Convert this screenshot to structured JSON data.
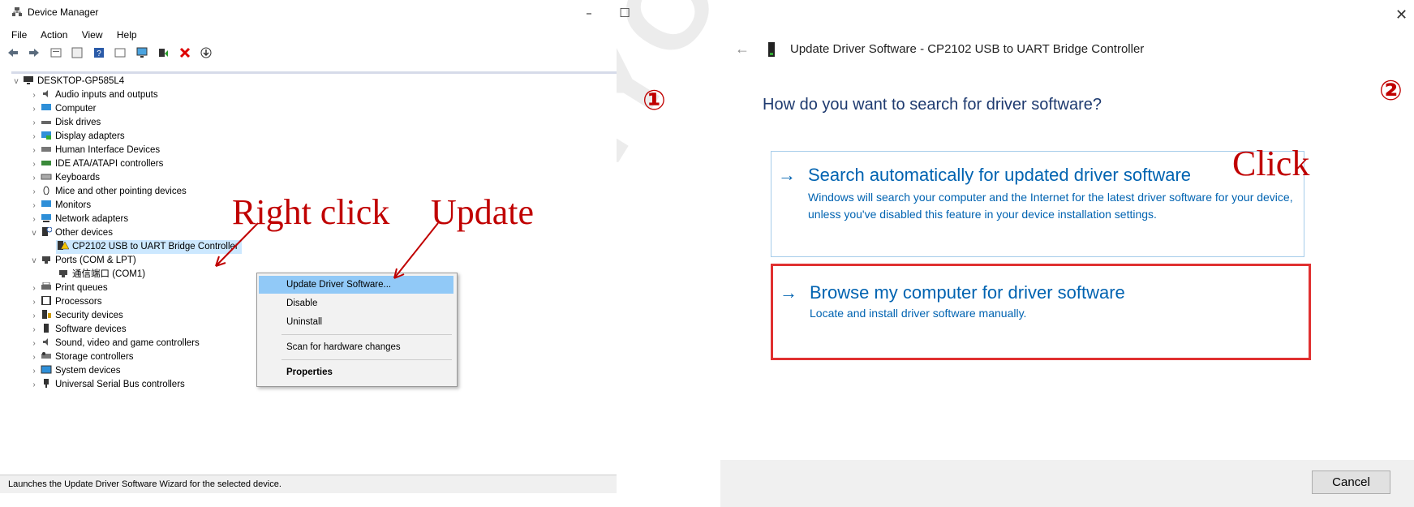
{
  "device_manager": {
    "title": "Device Manager",
    "menu": [
      "File",
      "Action",
      "View",
      "Help"
    ],
    "root": "DESKTOP-GP585L4",
    "nodes": [
      "Audio inputs and outputs",
      "Computer",
      "Disk drives",
      "Display adapters",
      "Human Interface Devices",
      "IDE ATA/ATAPI controllers",
      "Keyboards",
      "Mice and other pointing devices",
      "Monitors",
      "Network adapters",
      "Other devices",
      "CP2102 USB to UART Bridge Controller",
      "Ports (COM & LPT)",
      "通信端口 (COM1)",
      "Print queues",
      "Processors",
      "Security devices",
      "Software devices",
      "Sound, video and game controllers",
      "Storage controllers",
      "System devices",
      "Universal Serial Bus controllers"
    ],
    "context_menu": [
      "Update Driver Software...",
      "Disable",
      "Uninstall",
      "Scan for hardware changes",
      "Properties"
    ],
    "status": "Launches the Update Driver Software Wizard for the selected device."
  },
  "annotations": {
    "right_click": "Right click",
    "update": "Update",
    "click": "Click",
    "step1": "①",
    "step2": "②",
    "watermark": "ANYCUBIC"
  },
  "dialog": {
    "header": "Update Driver Software - CP2102 USB to UART Bridge Controller",
    "question": "How do you want to search for driver software?",
    "option1_title": "Search automatically for updated driver software",
    "option1_desc": "Windows will search your computer and the Internet for the latest driver software for your device, unless you've disabled this feature in your device installation settings.",
    "option2_title": "Browse my computer for driver software",
    "option2_desc": "Locate and install driver software manually.",
    "cancel": "Cancel"
  }
}
